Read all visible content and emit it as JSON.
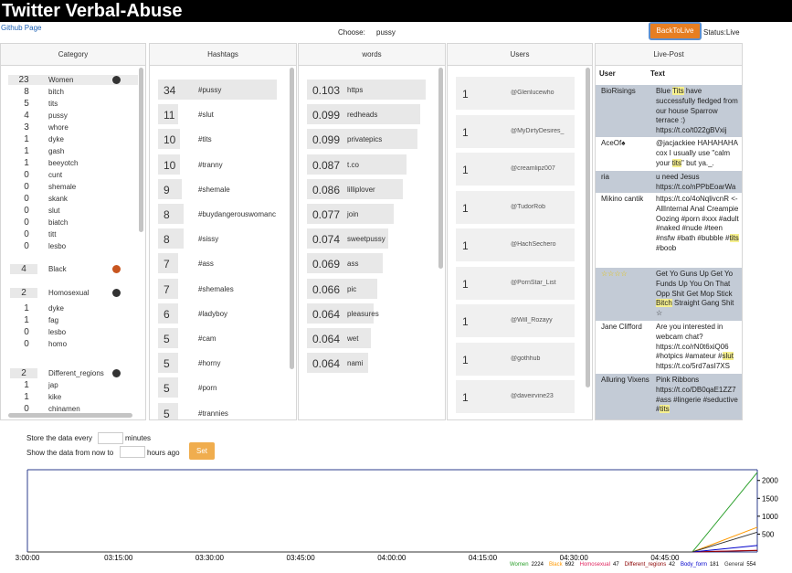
{
  "header": {
    "title": "Twitter Verbal-Abuse",
    "github_link": "Github Page",
    "choose_label": "Choose:",
    "choose_value": "pussy",
    "back_button": "BackToLive",
    "status_label": "Status:Live"
  },
  "colors": {
    "back_button": "#e67e22",
    "set_button": "#f0ad4e",
    "women_dot": "#333333",
    "black_dot": "#c8551f",
    "homosexual_dot": "#333333",
    "regions_dot": "#333333"
  },
  "category": {
    "header": "Category",
    "women": {
      "count": "23",
      "label": "Women"
    },
    "women_items": [
      {
        "count": "8",
        "label": "bitch"
      },
      {
        "count": "5",
        "label": "tits"
      },
      {
        "count": "4",
        "label": "pussy"
      },
      {
        "count": "3",
        "label": "whore"
      },
      {
        "count": "1",
        "label": "dyke"
      },
      {
        "count": "1",
        "label": "gash"
      },
      {
        "count": "1",
        "label": "beeyotch"
      },
      {
        "count": "0",
        "label": "cunt"
      },
      {
        "count": "0",
        "label": "shemale"
      },
      {
        "count": "0",
        "label": "skank"
      },
      {
        "count": "0",
        "label": "slut"
      },
      {
        "count": "0",
        "label": "biatch"
      },
      {
        "count": "0",
        "label": "titt"
      },
      {
        "count": "0",
        "label": "lesbo"
      }
    ],
    "black": {
      "count": "4",
      "label": "Black"
    },
    "homosexual": {
      "count": "2",
      "label": "Homosexual"
    },
    "homosexual_items": [
      {
        "count": "1",
        "label": "dyke"
      },
      {
        "count": "1",
        "label": "fag"
      },
      {
        "count": "0",
        "label": "lesbo"
      },
      {
        "count": "0",
        "label": "homo"
      }
    ],
    "regions": {
      "count": "2",
      "label": "Different_regions"
    },
    "regions_items": [
      {
        "count": "1",
        "label": "jap"
      },
      {
        "count": "1",
        "label": "kike"
      },
      {
        "count": "0",
        "label": "chinamen"
      }
    ]
  },
  "hashtags": {
    "header": "Hashtags",
    "items": [
      {
        "count": "34",
        "label": "#pussy"
      },
      {
        "count": "11",
        "label": "#slut"
      },
      {
        "count": "10",
        "label": "#tits"
      },
      {
        "count": "10",
        "label": "#tranny"
      },
      {
        "count": "9",
        "label": "#shemale"
      },
      {
        "count": "8",
        "label": "#buydangerouswomanc"
      },
      {
        "count": "8",
        "label": "#sissy"
      },
      {
        "count": "7",
        "label": "#ass"
      },
      {
        "count": "7",
        "label": "#shemales"
      },
      {
        "count": "6",
        "label": "#ladyboy"
      },
      {
        "count": "5",
        "label": "#cam"
      },
      {
        "count": "5",
        "label": "#horny"
      },
      {
        "count": "5",
        "label": "#porn"
      },
      {
        "count": "5",
        "label": "#trannies"
      }
    ]
  },
  "words": {
    "header": "words",
    "items": [
      {
        "score": "0.103",
        "label": "https"
      },
      {
        "score": "0.099",
        "label": "redheads"
      },
      {
        "score": "0.099",
        "label": "privatepics"
      },
      {
        "score": "0.087",
        "label": "t.co"
      },
      {
        "score": "0.086",
        "label": "lilliplover"
      },
      {
        "score": "0.077",
        "label": "join"
      },
      {
        "score": "0.074",
        "label": "sweetpussy"
      },
      {
        "score": "0.069",
        "label": "ass"
      },
      {
        "score": "0.066",
        "label": "pic"
      },
      {
        "score": "0.064",
        "label": "pleasures"
      },
      {
        "score": "0.064",
        "label": "wet"
      },
      {
        "score": "0.064",
        "label": "nami"
      }
    ]
  },
  "users": {
    "header": "Users",
    "items": [
      {
        "count": "1",
        "label": "@Glenlucewho"
      },
      {
        "count": "1",
        "label": "@MyDirtyDesires_"
      },
      {
        "count": "1",
        "label": "@creamlipz007"
      },
      {
        "count": "1",
        "label": "@TudorRob"
      },
      {
        "count": "1",
        "label": "@HachSechero"
      },
      {
        "count": "1",
        "label": "@PornStar_List"
      },
      {
        "count": "1",
        "label": "@Will_Rozayy"
      },
      {
        "count": "1",
        "label": "@gothhub"
      },
      {
        "count": "1",
        "label": "@daveirvine23"
      }
    ]
  },
  "live_post": {
    "header": "Live-Post",
    "col_user": "User",
    "col_text": "Text",
    "posts": [
      {
        "user": "BioRisings",
        "t1": "Blue ",
        "h1": "Tits",
        "t2": " have successfully fledged from our house Sparrow terrace :) https://t.co/t022gBVxij"
      },
      {
        "user": "AceOf♠",
        "t1": "@jacjackiee HAHAHAHA cox I usually use \"calm your ",
        "h1": "tits",
        "t2": "\" but ya._."
      },
      {
        "user": "ria",
        "t1": "u need Jesus https://t.co/nPPbEoarWa",
        "h1": "",
        "t2": ""
      },
      {
        "user": "Mikino cantik",
        "t1": "https://t.co/4oNqlivcnR <-AllInternal Anal Creampie Oozing #porn #xxx #adult #naked #nude #teen #nsfw #bath #bubble #",
        "h1": "tits",
        "t2": " #boob"
      },
      {
        "user": "☆☆☆☆",
        "t1": "Get Yo Guns Up Get Yo Funds Up You On That Opp Shit Get Mop Stick ",
        "h1": "Bitch",
        "t2": " Straight Gang Shit ☆"
      },
      {
        "user": "Jane Clifford",
        "t1": "Are you interested in webcam chat? https://t.co/rN0t6xiQ06 #hotpics #amateur #",
        "h1": "slut",
        "t2": " https://t.co/5rd7asI7XS"
      },
      {
        "user": "Alluring Vixens",
        "t1": "Pink Ribbons https://t.co/DB0qaE1ZZ7 #ass #lingerie #seductive #",
        "h1": "tits",
        "t2": ""
      }
    ]
  },
  "controls": {
    "store_label": "Store the data every",
    "store_unit": "minutes",
    "show_label": "Show the data from now to",
    "show_unit": "hours ago",
    "set_button": "Set"
  },
  "chart_data": {
    "type": "line",
    "x": [
      "03:00:00",
      "03:15:00",
      "03:30:00",
      "03:45:00",
      "04:00:00",
      "04:15:00",
      "04:30:00",
      "04:45:00",
      "04:55:00"
    ],
    "x_ticks": [
      "3:00:00",
      "03:15:00",
      "03:30:00",
      "03:45:00",
      "04:00:00",
      "04:15:00",
      "04:30:00",
      "04:45:00"
    ],
    "y_ticks": [
      500,
      1000,
      1500,
      2000
    ],
    "ylim": [
      0,
      2300
    ],
    "series": [
      {
        "name": "Women",
        "color": "#2ca02c",
        "values": [
          0,
          0,
          0,
          0,
          0,
          0,
          0,
          0,
          2224
        ]
      },
      {
        "name": "Black",
        "color": "#ff9900",
        "values": [
          0,
          0,
          0,
          0,
          0,
          0,
          0,
          0,
          692
        ]
      },
      {
        "name": "Homosexual",
        "color": "#e0245e",
        "values": [
          0,
          0,
          0,
          0,
          0,
          0,
          0,
          0,
          47
        ]
      },
      {
        "name": "Different_regions",
        "color": "#8b0000",
        "values": [
          0,
          0,
          0,
          0,
          0,
          0,
          0,
          0,
          42
        ]
      },
      {
        "name": "Body_form",
        "color": "#0000cc",
        "values": [
          0,
          0,
          0,
          0,
          0,
          0,
          0,
          0,
          181
        ]
      },
      {
        "name": "General",
        "color": "#333333",
        "values": [
          0,
          0,
          0,
          0,
          0,
          0,
          0,
          0,
          554
        ]
      }
    ],
    "legend": [
      {
        "name": "Women",
        "value": "2224",
        "color": "#2ca02c"
      },
      {
        "name": "Black",
        "value": "692",
        "color": "#ff9900"
      },
      {
        "name": "Homosexual",
        "value": "47",
        "color": "#e0245e"
      },
      {
        "name": "Different_regions",
        "value": "42",
        "color": "#8b0000"
      },
      {
        "name": "Body_form",
        "value": "181",
        "color": "#0000cc"
      },
      {
        "name": "General",
        "value": "554",
        "color": "#333333"
      }
    ]
  }
}
